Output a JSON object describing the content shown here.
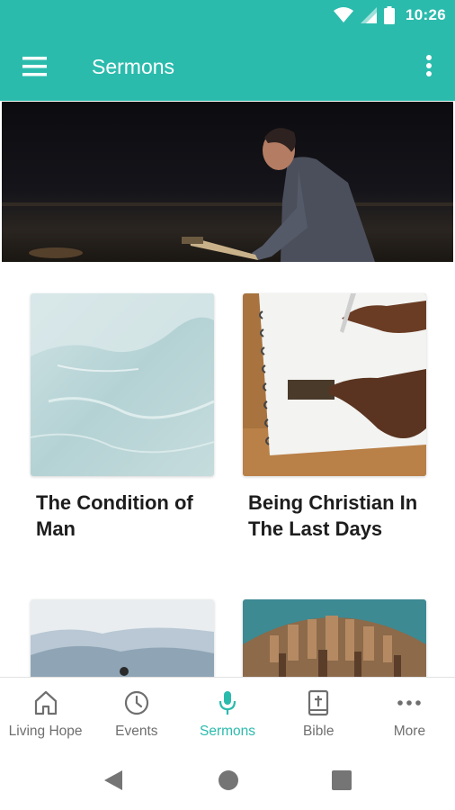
{
  "status_bar": {
    "time": "10:26"
  },
  "app_bar": {
    "title": "Sermons"
  },
  "sermons": [
    {
      "title": "The Condition of Man"
    },
    {
      "title": "Being Christian In The Last Days"
    }
  ],
  "bottom_nav": {
    "items": [
      {
        "label": "Living Hope",
        "icon": "home-icon"
      },
      {
        "label": "Events",
        "icon": "clock-icon"
      },
      {
        "label": "Sermons",
        "icon": "microphone-icon",
        "active": true
      },
      {
        "label": "Bible",
        "icon": "bible-icon"
      },
      {
        "label": "More",
        "icon": "more-horizontal-icon"
      }
    ]
  },
  "colors": {
    "accent": "#2bbbad",
    "nav_inactive": "#6f6f6f",
    "title_text": "#1d1d1d"
  }
}
